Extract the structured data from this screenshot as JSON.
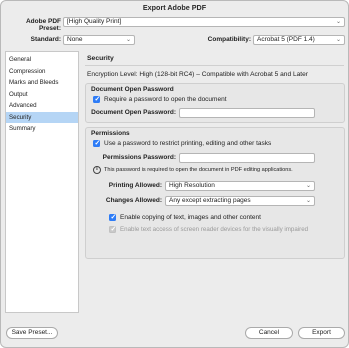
{
  "window": {
    "title": "Export Adobe PDF"
  },
  "top": {
    "preset_label": "Adobe PDF Preset:",
    "preset_value": "[High Quality Print]",
    "standard_label": "Standard:",
    "standard_value": "None",
    "compat_label": "Compatibility:",
    "compat_value": "Acrobat 5 (PDF 1.4)"
  },
  "sidebar": {
    "items": [
      {
        "label": "General"
      },
      {
        "label": "Compression"
      },
      {
        "label": "Marks and Bleeds"
      },
      {
        "label": "Output"
      },
      {
        "label": "Advanced"
      },
      {
        "label": "Security"
      },
      {
        "label": "Summary"
      }
    ],
    "selected": "Security"
  },
  "security": {
    "heading": "Security",
    "encryption_level": "Encryption Level: High (128-bit RC4) – Compatible with Acrobat 5 and Later",
    "open_password": {
      "heading": "Document Open Password",
      "require_label": "Require a password to open the document",
      "require_checked": true,
      "field_label": "Document Open Password:",
      "field_value": ""
    },
    "permissions": {
      "heading": "Permissions",
      "restrict_label": "Use a password to restrict printing, editing and other tasks",
      "restrict_checked": true,
      "field_label": "Permissions Password:",
      "field_value": "",
      "info_text": "This password is required to open the document in PDF editing applications.",
      "printing_label": "Printing Allowed:",
      "printing_value": "High Resolution",
      "changes_label": "Changes Allowed:",
      "changes_value": "Any except extracting pages",
      "copy_label": "Enable copying of text, images and other content",
      "copy_checked": true,
      "screenreader_label": "Enable text access of screen reader devices for the visually impaired",
      "screenreader_checked": true
    }
  },
  "footer": {
    "save_preset": "Save Preset...",
    "cancel": "Cancel",
    "export": "Export"
  },
  "colors": {
    "accent": "#2e7cf6",
    "selection": "#b5d5f5"
  },
  "icons": [
    "chevron-down-icon",
    "checkmark-icon",
    "info-icon"
  ]
}
